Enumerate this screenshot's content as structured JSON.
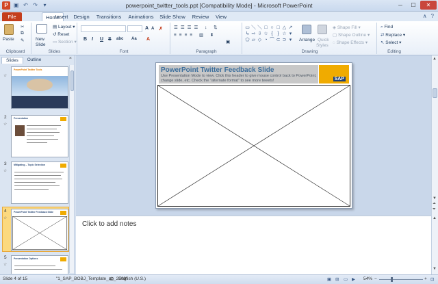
{
  "window": {
    "title": "powerpoint_twitter_tools.ppt [Compatibility Mode] - Microsoft PowerPoint",
    "app_icon": "P"
  },
  "tabs": [
    "File",
    "Home",
    "Insert",
    "Design",
    "Transitions",
    "Animations",
    "Slide Show",
    "Review",
    "View"
  ],
  "ribbon": {
    "clipboard": {
      "paste": "Paste",
      "label": "Clipboard"
    },
    "slides": {
      "new_slide_1": "New",
      "new_slide_2": "Slide",
      "layout": "Layout",
      "reset": "Reset",
      "section": "Section",
      "label": "Slides"
    },
    "font": {
      "label": "Font",
      "bold": "B",
      "italic": "I",
      "underline": "U",
      "strike": "S",
      "shadow": "abc",
      "grow": "A",
      "shrink": "A",
      "clear": "Aa"
    },
    "paragraph": {
      "label": "Paragraph"
    },
    "drawing": {
      "arrange": "Arrange",
      "quick_1": "Quick",
      "quick_2": "Styles",
      "shape_fill": "Shape Fill",
      "shape_outline": "Shape Outline",
      "shape_effects": "Shape Effects",
      "label": "Drawing"
    },
    "editing": {
      "find": "Find",
      "replace": "Replace",
      "select": "Select",
      "label": "Editing"
    }
  },
  "panel": {
    "tabs": [
      "Slides",
      "Outline"
    ],
    "close": "×",
    "thumbs": [
      {
        "num": "2",
        "title": "Presentation"
      },
      {
        "num": "3",
        "title": "Mitigating – Topic Selection"
      },
      {
        "num": "4",
        "title": "PowerPoint Twitter Feedback Slide"
      },
      {
        "num": "5",
        "title": "Presentation Options"
      }
    ],
    "thumb1_title": "PowerPoint Twitter Tools"
  },
  "slide": {
    "title": "PowerPoint Twitter Feedback Slide",
    "subtitle": "Use Presentation Mode to view. Click this header to give mouse control back to PowerPoint, change slide, etc. Check the \"alternate format\" to see more tweets!",
    "logo": "SAP"
  },
  "notes": {
    "placeholder": "Click to add notes"
  },
  "status": {
    "slide": "Slide 4 of 15",
    "theme": "\"1_SAP_BOBJ_Template_ab_2009\"",
    "language": "English (U.S.)",
    "zoom": "54%"
  }
}
